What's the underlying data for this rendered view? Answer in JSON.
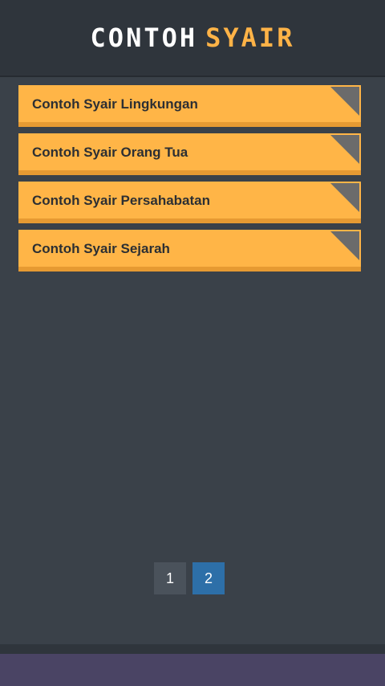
{
  "header": {
    "title_part1": "CONTOH",
    "title_part2": "SYAIR"
  },
  "list": {
    "items": [
      {
        "label": "Contoh Syair Lingkungan"
      },
      {
        "label": "Contoh Syair Orang Tua"
      },
      {
        "label": "Contoh Syair Persahabatan"
      },
      {
        "label": "Contoh Syair Sejarah"
      }
    ]
  },
  "pagination": {
    "pages": [
      "1",
      "2"
    ],
    "active_page": "2"
  },
  "colors": {
    "accent": "#ffb547",
    "active_page": "#2d6fa8",
    "background": "#3a4149"
  }
}
